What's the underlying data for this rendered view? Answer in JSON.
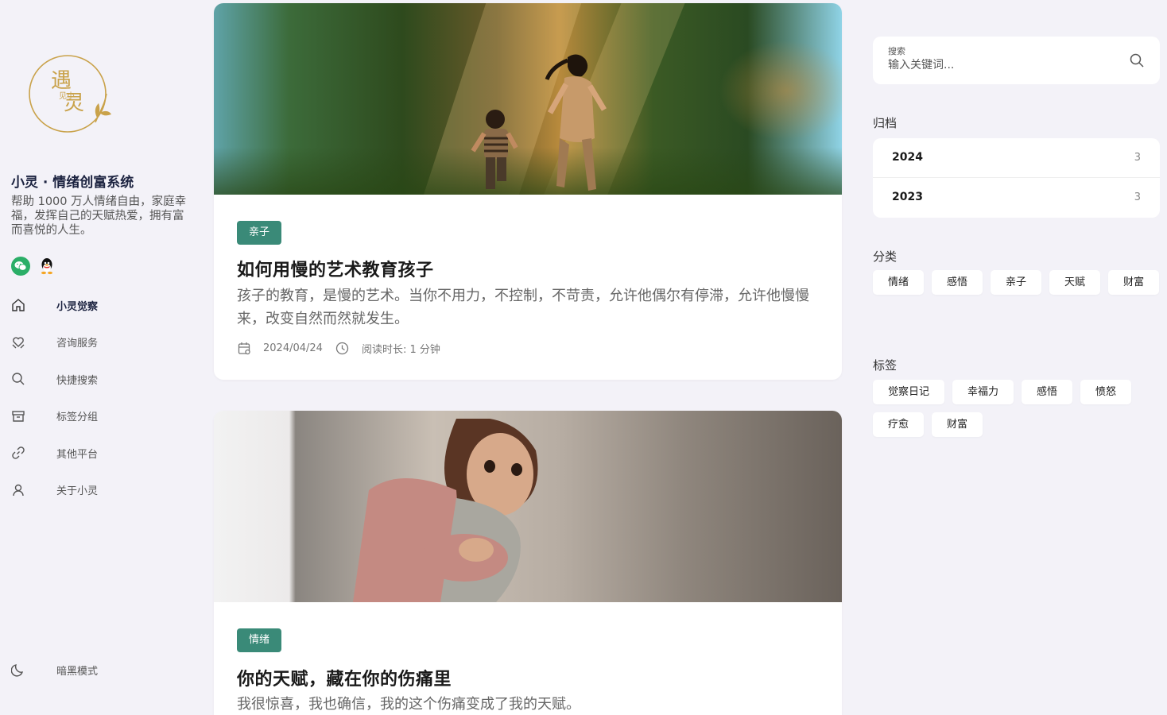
{
  "site": {
    "logo_text": "遇见小灵",
    "title": "小灵 · 情绪创富系统",
    "description": "帮助 1000 万人情绪自由，家庭幸福，发挥自己的天赋热爱，拥有富而喜悦的人生。"
  },
  "social": [
    {
      "name": "wechat-icon",
      "color": "#2aae67"
    },
    {
      "name": "qq-icon"
    }
  ],
  "nav": {
    "items": [
      {
        "label": "小灵觉察",
        "icon": "home-icon",
        "active": true
      },
      {
        "label": "咨询服务",
        "icon": "heart-hand-icon"
      },
      {
        "label": "快捷搜索",
        "icon": "search-icon"
      },
      {
        "label": "标签分组",
        "icon": "archive-icon"
      },
      {
        "label": "其他平台",
        "icon": "link-icon"
      },
      {
        "label": "关于小灵",
        "icon": "user-icon"
      }
    ],
    "dark_mode_label": "暗黑模式"
  },
  "posts": [
    {
      "category": "亲子",
      "title": "如何用慢的艺术教育孩子",
      "excerpt": "孩子的教育，是慢的艺术。当你不用力，不控制，不苛责，允许他偶尔有停滞，允许他慢慢来，改变自然而然就发生。",
      "date": "2024/04/24",
      "read_time": "阅读时长: 1 分钟"
    },
    {
      "category": "情绪",
      "title": "你的天赋，藏在你的伤痛里",
      "excerpt": "我很惊喜，我也确信，我的这个伤痛变成了我的天赋。"
    }
  ],
  "search": {
    "label": "搜索",
    "placeholder": "输入关键词..."
  },
  "archive": {
    "title": "归档",
    "items": [
      {
        "year": "2024",
        "count": "3"
      },
      {
        "year": "2023",
        "count": "3"
      }
    ]
  },
  "categories": {
    "title": "分类",
    "items": [
      "情绪",
      "感悟",
      "亲子",
      "天赋",
      "财富"
    ]
  },
  "tags": {
    "title": "标签",
    "items": [
      "觉察日记",
      "幸福力",
      "感悟",
      "愤怒",
      "疗愈",
      "财富"
    ]
  },
  "colors": {
    "accent": "#3a8a78",
    "background": "#f3f2f8",
    "logo_gold": "#c9a24a"
  }
}
